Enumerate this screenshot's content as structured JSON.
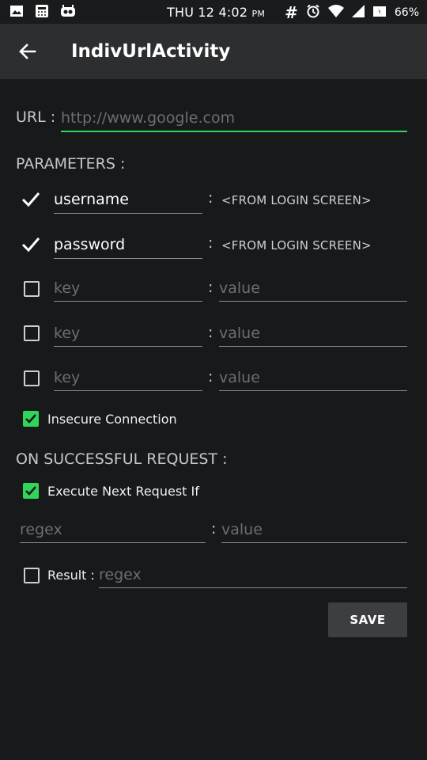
{
  "status_bar": {
    "time": "THU 12 4:02",
    "ampm": "PM",
    "battery": "66%"
  },
  "appbar": {
    "title": "IndivUrlActivity"
  },
  "url": {
    "label": "URL :",
    "placeholder": "http://www.google.com",
    "value": ""
  },
  "parameters": {
    "heading": "PARAMETERS :",
    "rows": [
      {
        "key": "username",
        "value_label": "<FROM LOGIN SCREEN>",
        "checked": true
      },
      {
        "key": "password",
        "value_label": "<FROM LOGIN SCREEN>",
        "checked": true
      },
      {
        "key_placeholder": "key",
        "value_placeholder": "value",
        "checked": false
      },
      {
        "key_placeholder": "key",
        "value_placeholder": "value",
        "checked": false
      },
      {
        "key_placeholder": "key",
        "value_placeholder": "value",
        "checked": false
      }
    ]
  },
  "insecure": {
    "label": "Insecure Connection",
    "checked": true
  },
  "success": {
    "heading": "ON SUCCESSFUL REQUEST :",
    "execute_next": {
      "label": "Execute Next Request If",
      "checked": true
    },
    "regex_placeholder": "regex",
    "value_placeholder": "value",
    "result": {
      "label": "Result :",
      "placeholder": "regex",
      "checked": false
    }
  },
  "save_label": "SAVE",
  "colon": ":",
  "colors": {
    "accent": "#2fd65a",
    "background": "#18191b",
    "appbar": "#2d2e30"
  }
}
